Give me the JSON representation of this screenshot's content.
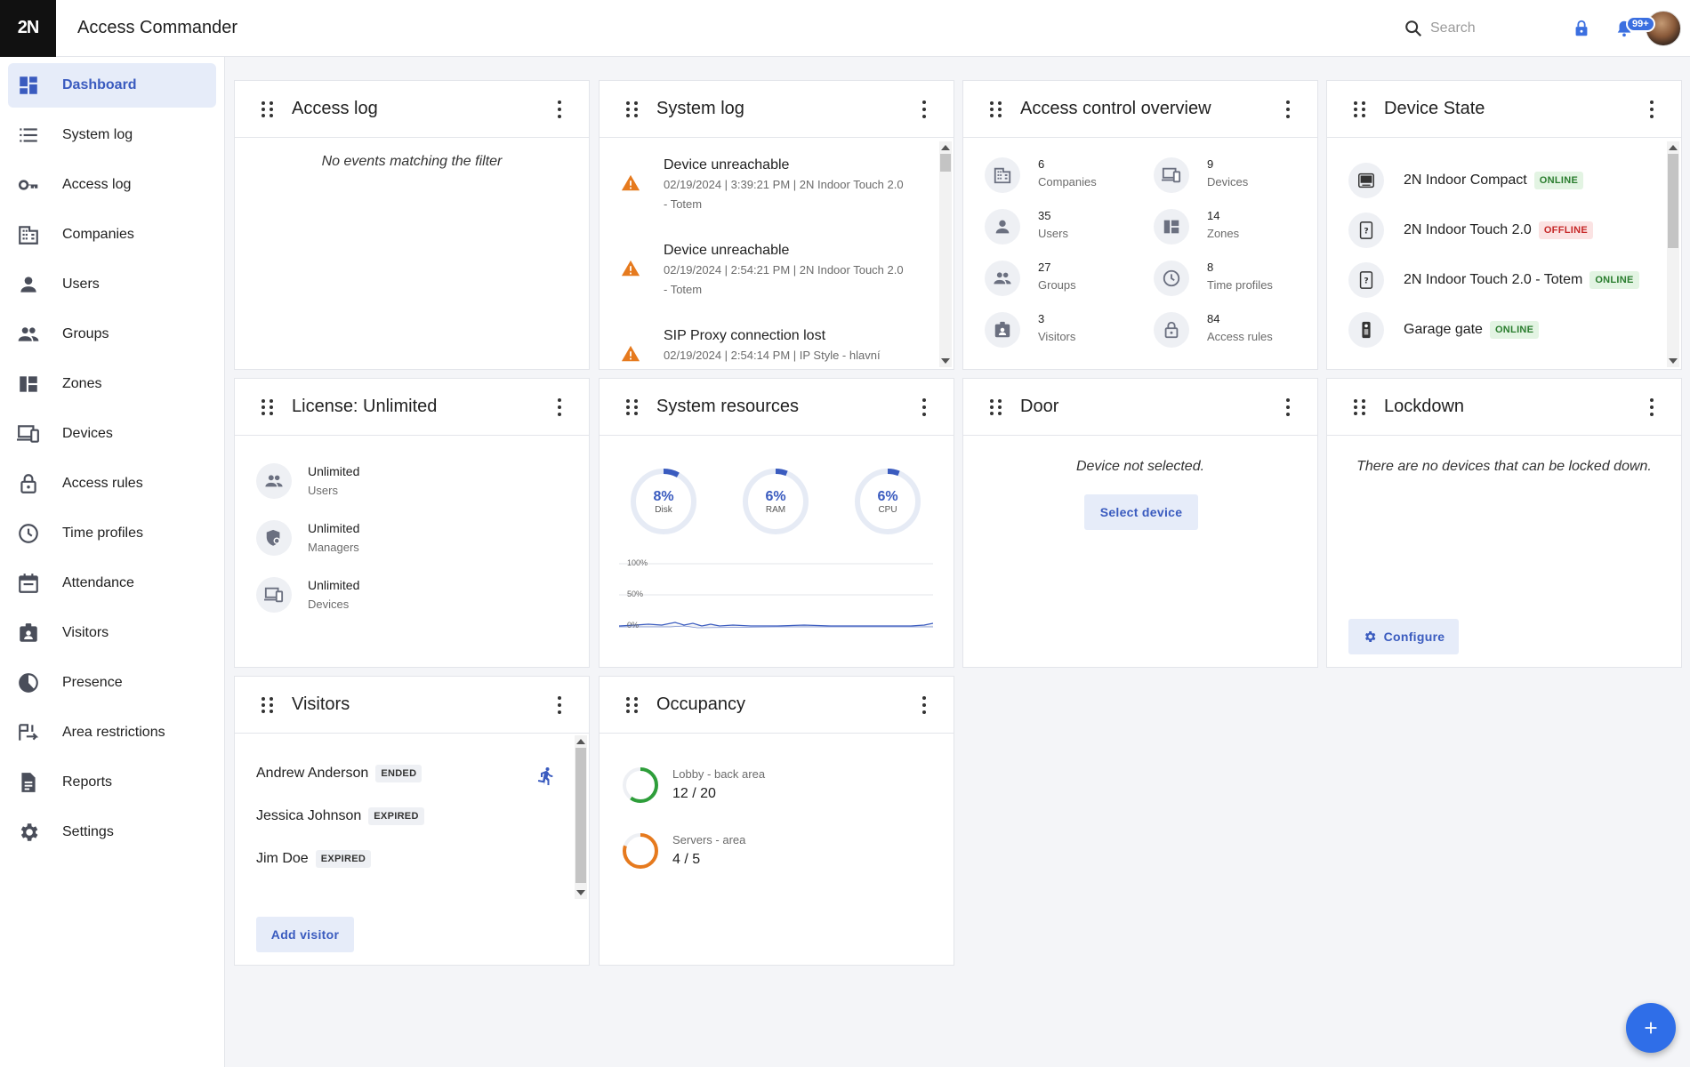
{
  "app": {
    "logo": "2N",
    "title": "Access Commander"
  },
  "header": {
    "search_placeholder": "Search",
    "notifications_badge": "99+"
  },
  "sidebar": {
    "items": [
      {
        "label": "Dashboard",
        "icon": "dashboard-icon",
        "active": true
      },
      {
        "label": "System log",
        "icon": "list-icon"
      },
      {
        "label": "Access log",
        "icon": "key-icon"
      },
      {
        "label": "Companies",
        "icon": "building-icon"
      },
      {
        "label": "Users",
        "icon": "person-icon"
      },
      {
        "label": "Groups",
        "icon": "group-icon"
      },
      {
        "label": "Zones",
        "icon": "zones-icon"
      },
      {
        "label": "Devices",
        "icon": "devices-icon"
      },
      {
        "label": "Access rules",
        "icon": "lock-icon"
      },
      {
        "label": "Time profiles",
        "icon": "clock-icon"
      },
      {
        "label": "Attendance",
        "icon": "calendar-icon"
      },
      {
        "label": "Visitors",
        "icon": "visitor-badge-icon"
      },
      {
        "label": "Presence",
        "icon": "presence-icon"
      },
      {
        "label": "Area restrictions",
        "icon": "area-restriction-icon"
      },
      {
        "label": "Reports",
        "icon": "report-icon"
      },
      {
        "label": "Settings",
        "icon": "gear-icon"
      }
    ]
  },
  "widgets": {
    "access_log": {
      "title": "Access log",
      "empty_message": "No events matching the filter"
    },
    "system_log": {
      "title": "System log",
      "entries": [
        {
          "title": "Device unreachable",
          "detail1": "02/19/2024 | 3:39:21 PM | 2N Indoor Touch 2.0",
          "detail2": "- Totem"
        },
        {
          "title": "Device unreachable",
          "detail1": "02/19/2024 | 2:54:21 PM | 2N Indoor Touch 2.0",
          "detail2": "- Totem"
        },
        {
          "title": "SIP Proxy connection lost",
          "detail1": "02/19/2024 | 2:54:14 PM | IP Style - hlavní",
          "detail2": ""
        }
      ]
    },
    "overview": {
      "title": "Access control overview",
      "items": [
        {
          "count": "6",
          "label": "Companies",
          "icon": "building-icon"
        },
        {
          "count": "9",
          "label": "Devices",
          "icon": "devices-icon"
        },
        {
          "count": "35",
          "label": "Users",
          "icon": "person-icon"
        },
        {
          "count": "14",
          "label": "Zones",
          "icon": "zones-icon"
        },
        {
          "count": "27",
          "label": "Groups",
          "icon": "group-icon"
        },
        {
          "count": "8",
          "label": "Time profiles",
          "icon": "clock-icon"
        },
        {
          "count": "3",
          "label": "Visitors",
          "icon": "visitor-badge-icon"
        },
        {
          "count": "84",
          "label": "Access rules",
          "icon": "lock-icon"
        }
      ]
    },
    "device_state": {
      "title": "Device State",
      "devices": [
        {
          "name": "2N Indoor Compact",
          "status": "ONLINE",
          "icon": "indoor-compact-icon"
        },
        {
          "name": "2N Indoor Touch 2.0",
          "status": "OFFLINE",
          "icon": "indoor-touch-icon"
        },
        {
          "name": "2N Indoor Touch 2.0 - Totem",
          "status": "ONLINE",
          "icon": "indoor-touch-icon"
        },
        {
          "name": "Garage gate",
          "status": "ONLINE",
          "icon": "intercom-icon"
        }
      ]
    },
    "license": {
      "title": "License: Unlimited",
      "rows": [
        {
          "value": "Unlimited",
          "label": "Users",
          "icon": "group-icon"
        },
        {
          "value": "Unlimited",
          "label": "Managers",
          "icon": "manager-shield-icon"
        },
        {
          "value": "Unlimited",
          "label": "Devices",
          "icon": "devices-icon"
        }
      ]
    },
    "resources": {
      "title": "System resources",
      "gauges": [
        {
          "value": "8%",
          "label": "Disk",
          "percent": 8
        },
        {
          "value": "6%",
          "label": "RAM",
          "percent": 6
        },
        {
          "value": "6%",
          "label": "CPU",
          "percent": 6
        }
      ],
      "chart_axis": [
        "100%",
        "50%",
        "0%"
      ]
    },
    "door": {
      "title": "Door",
      "message": "Device not selected.",
      "button": "Select device"
    },
    "lockdown": {
      "title": "Lockdown",
      "message": "There are no devices that can be locked down.",
      "button": "Configure"
    },
    "visitors": {
      "title": "Visitors",
      "rows": [
        {
          "name": "Andrew Anderson",
          "status": "ENDED"
        },
        {
          "name": "Jessica Johnson",
          "status": "EXPIRED"
        },
        {
          "name": "Jim Doe",
          "status": "EXPIRED"
        }
      ],
      "add_button": "Add visitor"
    },
    "occupancy": {
      "title": "Occupancy",
      "areas": [
        {
          "name": "Lobby - back area",
          "value": "12 / 20",
          "fraction": 0.6,
          "color": "#2e9e3a"
        },
        {
          "name": "Servers - area",
          "value": "4 / 5",
          "fraction": 0.8,
          "color": "#e67a1e"
        }
      ]
    }
  },
  "colors": {
    "accent": "#3a5bbf",
    "fab": "#2f6ee8",
    "online": "#2a7d2e",
    "offline": "#c62828",
    "warning": "#e67a1e"
  }
}
